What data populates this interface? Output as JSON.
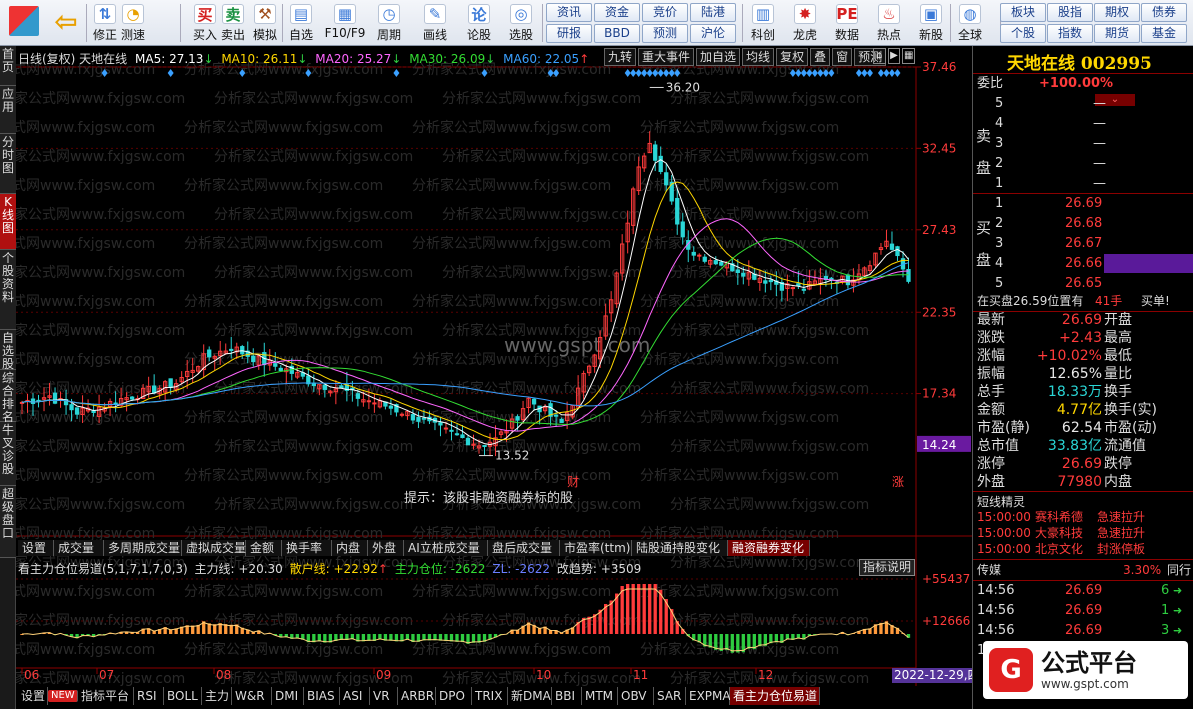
{
  "toolbar": {
    "buttons": [
      {
        "label": "修正",
        "icon": "arrow-up-down-icon"
      },
      {
        "label": "测速",
        "icon": "speedometer-icon"
      },
      {
        "label": "买入",
        "glyph": "买",
        "icon": "buy-icon"
      },
      {
        "label": "卖出",
        "glyph": "卖",
        "icon": "sell-icon"
      },
      {
        "label": "模拟",
        "icon": "hammer-icon"
      },
      {
        "label": "自选",
        "icon": "folder-icon"
      },
      {
        "label": "F10/F9",
        "icon": "grid-icon"
      },
      {
        "label": "周期",
        "icon": "clock-icon"
      },
      {
        "label": "画线",
        "icon": "pencil-icon"
      },
      {
        "label": "论股",
        "glyph": "论",
        "icon": "discuss-icon"
      },
      {
        "label": "选股",
        "icon": "chart-search-icon"
      },
      {
        "label": "科创",
        "icon": "chart-board-icon"
      },
      {
        "label": "龙虎",
        "icon": "dragon-icon"
      },
      {
        "label": "数据",
        "glyph": "PE",
        "icon": "data-icon"
      },
      {
        "label": "热点",
        "icon": "fire-icon"
      },
      {
        "label": "新股",
        "icon": "ipo-icon"
      },
      {
        "label": "全球",
        "icon": "globe-icon"
      }
    ],
    "quick_top": [
      "资讯",
      "资金",
      "竞价",
      "陆港"
    ],
    "quick_bottom": [
      "研报",
      "BBD",
      "预测",
      "沪伦"
    ],
    "right_top": [
      "板块",
      "股指",
      "期权",
      "债券"
    ],
    "right_bottom": [
      "个股",
      "指数",
      "期货",
      "基金"
    ]
  },
  "left_tabs": [
    "首页",
    "应用",
    "分时图",
    "K线图",
    "个股资料",
    "自选股",
    "综合排名",
    "牛叉诊股",
    "超级盘口"
  ],
  "header": {
    "title": "日线(复权)  天地在线",
    "ma5": "MA5: 27.13",
    "ma10": "MA10: 26.11",
    "ma20": "MA20: 25.27",
    "ma30": "MA30: 26.09",
    "ma60": "MA60: 22.05",
    "tools": [
      "九转",
      "重大事件",
      "加自选",
      "均线",
      "复权",
      "叠",
      "窗",
      "预测"
    ]
  },
  "colors": {
    "up": "#ff3b3b",
    "down": "#2ad6d6",
    "ma5": "#ffffff",
    "ma10": "#ffd700",
    "ma20": "#ff66ff",
    "ma30": "#33dd33",
    "ma60": "#3aa0ff",
    "marker": "#3aa0ff"
  },
  "watermark": "分析家公式网www.fxjgsw.com",
  "center_watermark": "www.gspt.com",
  "hint": "提示：该股非融资融券标的股",
  "chart_data": [
    {
      "type": "candlestick",
      "title": "日线(复权) 天地在线",
      "y_ticks": [
        37.46,
        32.45,
        27.43,
        22.35,
        17.34
      ],
      "ylim": [
        12.2,
        37.46
      ],
      "last_price_label": "14.24",
      "annotations": [
        {
          "text": "36.20",
          "value": 36.2
        },
        {
          "text": "13.52",
          "value": 13.52
        },
        {
          "text": "财"
        },
        {
          "text": "涨"
        }
      ],
      "x_labels": [
        "06",
        "07",
        "08",
        "09",
        "10",
        "11",
        "12"
      ],
      "date_label": "2022-12-29,四",
      "series_names": [
        "MA5",
        "MA10",
        "MA20",
        "MA30",
        "MA60"
      ],
      "close_anchors": [
        [
          0,
          16.8
        ],
        [
          5,
          17.2
        ],
        [
          10,
          16.2
        ],
        [
          14,
          16.5
        ],
        [
          18,
          17.0
        ],
        [
          22,
          17.4
        ],
        [
          28,
          18.0
        ],
        [
          33,
          19.5
        ],
        [
          38,
          20.2
        ],
        [
          43,
          19.4
        ],
        [
          48,
          18.8
        ],
        [
          53,
          18.0
        ],
        [
          58,
          17.6
        ],
        [
          62,
          17.0
        ],
        [
          66,
          16.6
        ],
        [
          70,
          16.1
        ],
        [
          73,
          15.6
        ],
        [
          77,
          15.0
        ],
        [
          80,
          14.6
        ],
        [
          83,
          14.2
        ],
        [
          86,
          14.5
        ],
        [
          89,
          15.5
        ],
        [
          92,
          17.0
        ],
        [
          95,
          16.2
        ],
        [
          98,
          15.5
        ],
        [
          101,
          17.5
        ],
        [
          104,
          20.0
        ],
        [
          107,
          23.0
        ],
        [
          110,
          28.0
        ],
        [
          112,
          31.5
        ],
        [
          114,
          33.0
        ],
        [
          116,
          31.0
        ],
        [
          118,
          29.0
        ],
        [
          120,
          27.0
        ],
        [
          122,
          26.0
        ],
        [
          126,
          25.5
        ],
        [
          130,
          25.0
        ],
        [
          134,
          24.5
        ],
        [
          138,
          24.0
        ],
        [
          142,
          23.8
        ],
        [
          146,
          24.5
        ],
        [
          150,
          24.3
        ],
        [
          154,
          25.5
        ],
        [
          157,
          26.8
        ],
        [
          160,
          25.0
        ],
        [
          161,
          24.3
        ]
      ],
      "candle_count": 162
    },
    {
      "type": "bar",
      "title": "看主力仓位易道(5,1,7,1,7,0,3)",
      "values_text": {
        "zhuli": "主力线: +20.30",
        "sanhu": "散户线: +22.92",
        "cangwei": "主力仓位: -2622",
        "zl": "ZL: -2622",
        "gaiqushi": "改趋势: +3509"
      },
      "y_ticks": [
        "+55437",
        "+12666"
      ],
      "button": "指标说明"
    }
  ],
  "indicator_tabs": [
    "设置",
    "成交量",
    "多周期成交量",
    "虚拟成交量",
    "金额",
    "换手率",
    "内盘",
    "外盘",
    "AI立桩成交量",
    "盘后成交量",
    "市盈率(ttm)",
    "陆股通持股变化",
    "融资融券变化"
  ],
  "bottom_tabs": [
    "设置",
    "NEW",
    "指标平台",
    "RSI",
    "BOLL",
    "主力",
    "W&R",
    "DMI",
    "BIAS",
    "ASI",
    "VR",
    "ARBR",
    "DPO",
    "TRIX",
    "新DMA",
    "BBI",
    "MTM",
    "OBV",
    "SAR",
    "EXPMA",
    "看主力仓位易道"
  ],
  "right_panel": {
    "stock_title": "天地在线 002995",
    "weibi_label": "委比",
    "weibi_value": "+100.00%",
    "sell_label": "卖盘",
    "buy_label": "买盘",
    "sell_levels": [
      {
        "level": "5",
        "price": "",
        "vol": "—"
      },
      {
        "level": "4",
        "price": "",
        "vol": "—"
      },
      {
        "level": "3",
        "price": "",
        "vol": "—"
      },
      {
        "level": "2",
        "price": "",
        "vol": "—"
      },
      {
        "level": "1",
        "price": "",
        "vol": "—"
      }
    ],
    "buy_levels": [
      {
        "level": "1",
        "price": "26.69"
      },
      {
        "level": "2",
        "price": "26.68"
      },
      {
        "level": "3",
        "price": "26.67"
      },
      {
        "level": "4",
        "price": "26.66"
      },
      {
        "level": "5",
        "price": "26.65"
      }
    ],
    "in_buy_text": "在买盘26.59位置有",
    "in_buy_qty": "41手",
    "in_buy_tag": "买单!",
    "quotes_left": [
      {
        "label": "最新",
        "value": "26.69"
      },
      {
        "label": "涨跌",
        "value": "+2.43"
      },
      {
        "label": "涨幅",
        "value": "+10.02%"
      },
      {
        "label": "振幅",
        "value": "12.65%"
      },
      {
        "label": "总手",
        "value": "18.33万"
      },
      {
        "label": "金额",
        "value": "4.77亿"
      },
      {
        "label": "市盈(静)",
        "value": "62.54"
      },
      {
        "label": "总市值",
        "value": "33.83亿"
      },
      {
        "label": "涨停",
        "value": "26.69"
      },
      {
        "label": "外盘",
        "value": "77980"
      }
    ],
    "quotes_right": [
      "开盘",
      "最高",
      "最低",
      "量比",
      "换手",
      "换手(实)",
      "市盈(动)",
      "流通值",
      "跌停",
      "内盘"
    ],
    "sprite_title": "短线精灵",
    "sprites": [
      {
        "time": "15:00:00",
        "name": "赛科希德",
        "event": "急速拉升"
      },
      {
        "time": "15:00:00",
        "name": "大豪科技",
        "event": "急速拉升"
      },
      {
        "time": "15:00:00",
        "name": "北京文化",
        "event": "封涨停板"
      }
    ],
    "sector_label": "传媒",
    "sector_pct": "3.30%",
    "sector_extra": "同行",
    "ticks": [
      {
        "time": "14:56",
        "price": "26.69",
        "vol": "6"
      },
      {
        "time": "14:56",
        "price": "26.69",
        "vol": "1"
      },
      {
        "time": "14:56",
        "price": "26.69",
        "vol": "3"
      },
      {
        "time": "14:56",
        "price": "26.69",
        "vol": "6"
      }
    ],
    "logo_text": "公式平台",
    "logo_url": "www.gspt.com"
  }
}
